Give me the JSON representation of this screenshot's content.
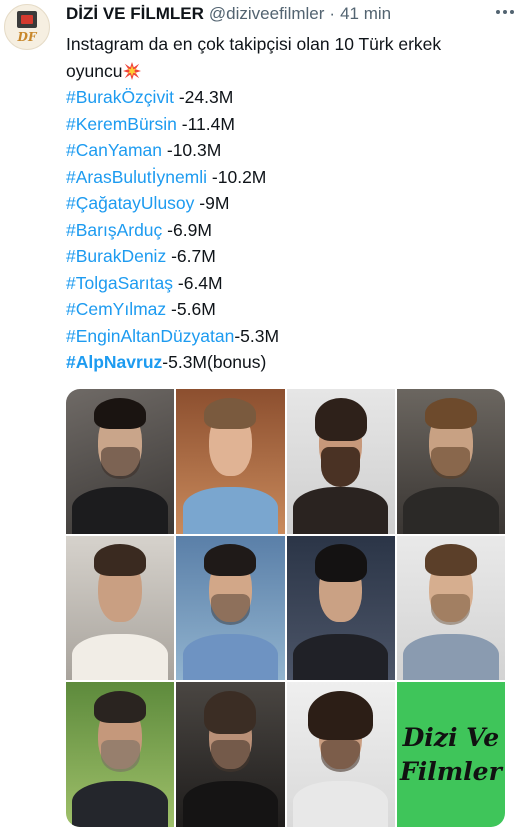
{
  "author": {
    "name": "DİZİ VE FİLMLER",
    "handle": "@diziveefilmler",
    "separator": "·",
    "time": "41 min",
    "avatar_monogram": "DF"
  },
  "tweet": {
    "line1": "Instagram da en çok takipçisi olan 10 Türk erkek",
    "line2": "oyuncu",
    "emoji_icon": "collision-icon",
    "entries": [
      {
        "tag": "#BurakÖzçivit",
        "value": " -24.3M"
      },
      {
        "tag": "#KeremBürsin",
        "value": " -11.4M"
      },
      {
        "tag": "#CanYaman",
        "value": " -10.3M"
      },
      {
        "tag": "#ArasBulutİynemli",
        "value": " -10.2M"
      },
      {
        "tag": "#ÇağatayUlusoy",
        "value": " -9M"
      },
      {
        "tag": "#BarışArduç",
        "value": " -6.9M"
      },
      {
        "tag": "#BurakDeniz",
        "value": " -6.7M"
      },
      {
        "tag": "#TolgaSarıtaş",
        "value": " -6.4M"
      },
      {
        "tag": "#CemYılmaz",
        "value": " -5.6M"
      },
      {
        "tag": "#EnginAltanDüzyatan",
        "value": "-5.3M"
      },
      {
        "tag": "#AlpNavruz",
        "value": "-5.3M(bonus)"
      }
    ]
  },
  "media": {
    "logo_line1": "Dizi Ve",
    "logo_line2": "Filmler",
    "accent_colors": {
      "link": "#1d9bf0",
      "logo_bg": "#3fc55a"
    }
  }
}
